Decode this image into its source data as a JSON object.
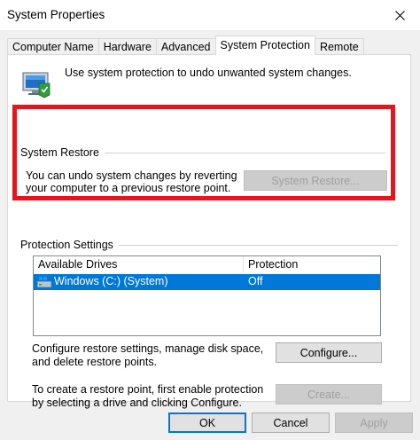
{
  "window": {
    "title": "System Properties",
    "close_icon": "close-icon"
  },
  "tabs": [
    {
      "label": "Computer Name",
      "active": false
    },
    {
      "label": "Hardware",
      "active": false
    },
    {
      "label": "Advanced",
      "active": false
    },
    {
      "label": "System Protection",
      "active": true
    },
    {
      "label": "Remote",
      "active": false
    }
  ],
  "intro": {
    "icon": "system-protection-icon",
    "text": "Use system protection to undo unwanted system changes."
  },
  "system_restore": {
    "group_label": "System Restore",
    "text": "You can undo system changes by reverting your computer to a previous restore point.",
    "button_label": "System Restore...",
    "highlight_color": "#e8141c"
  },
  "protection_settings": {
    "group_label": "Protection Settings",
    "columns": [
      "Available Drives",
      "Protection"
    ],
    "rows": [
      {
        "drive": "Windows (C:) (System)",
        "protection": "Off",
        "selected": true,
        "icon": "drive-icon"
      }
    ],
    "selection_color": "#0078d7",
    "configure_text": "Configure restore settings, manage disk space, and delete restore points.",
    "configure_button": "Configure...",
    "create_text": "To create a restore point, first enable protection by selecting a drive and clicking Configure.",
    "create_button": "Create..."
  },
  "footer": {
    "ok": "OK",
    "cancel": "Cancel",
    "apply": "Apply"
  }
}
